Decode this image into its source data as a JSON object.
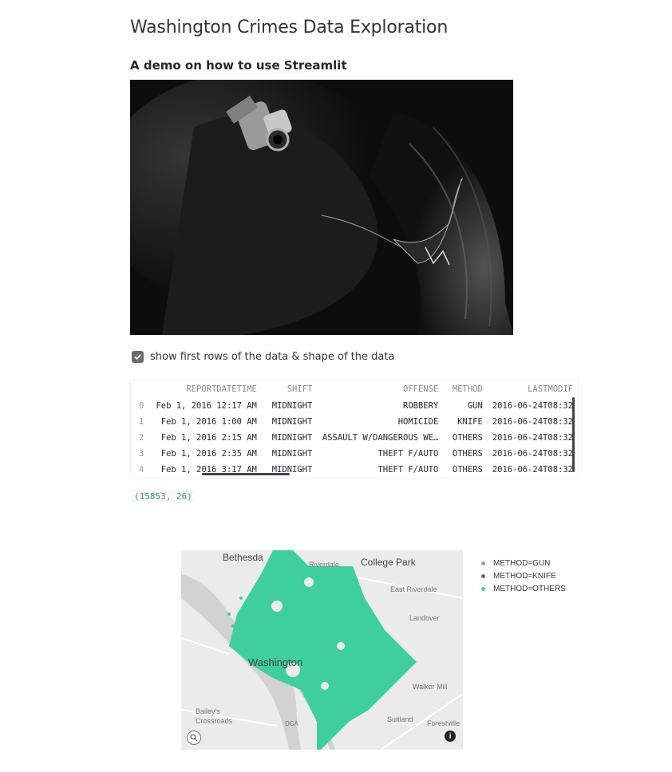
{
  "page": {
    "title": "Washington Crimes Data Exploration",
    "subtitle": "A demo on how to use Streamlit"
  },
  "checkbox": {
    "label": "show first rows of the data & shape of the data",
    "checked": true
  },
  "table": {
    "columns": [
      "",
      "REPORTDATETIME",
      "SHIFT",
      "OFFENSE",
      "METHOD",
      "LASTMODIF"
    ],
    "rows": [
      [
        "0",
        "Feb 1, 2016 12:17 AM",
        "MIDNIGHT",
        "ROBBERY",
        "GUN",
        "2016-06-24T08:32"
      ],
      [
        "1",
        "Feb 1, 2016 1:00 AM",
        "MIDNIGHT",
        "HOMICIDE",
        "KNIFE",
        "2016-06-24T08:32"
      ],
      [
        "2",
        "Feb 1, 2016 2:15 AM",
        "MIDNIGHT",
        "ASSAULT W/DANGEROUS WE…",
        "OTHERS",
        "2016-06-24T08:32"
      ],
      [
        "3",
        "Feb 1, 2016 2:35 AM",
        "MIDNIGHT",
        "THEFT F/AUTO",
        "OTHERS",
        "2016-06-24T08:32"
      ],
      [
        "4",
        "Feb 1, 2016 3:17 AM",
        "MIDNIGHT",
        "THEFT F/AUTO",
        "OTHERS",
        "2016-06-24T08:32"
      ]
    ]
  },
  "shape_text": "(15853, 26)",
  "map": {
    "place_labels": [
      "Bethesda",
      "College Park",
      "Riverdale",
      "East Riverdale",
      "Landover",
      "Washington",
      "Walker Mill",
      "Bailey's Crossroads",
      "DCA",
      "Suitland",
      "Forestville"
    ],
    "legend": [
      {
        "label": "METHOD=GUN",
        "color": "#9a9a9a"
      },
      {
        "label": "METHOD=KNIFE",
        "color": "#666666"
      },
      {
        "label": "METHOD=OTHERS",
        "color": "#3ecf9b"
      }
    ],
    "fill_color": "#3ecf9b"
  },
  "icons": [
    "checkmark-icon",
    "search-icon",
    "info-icon"
  ]
}
